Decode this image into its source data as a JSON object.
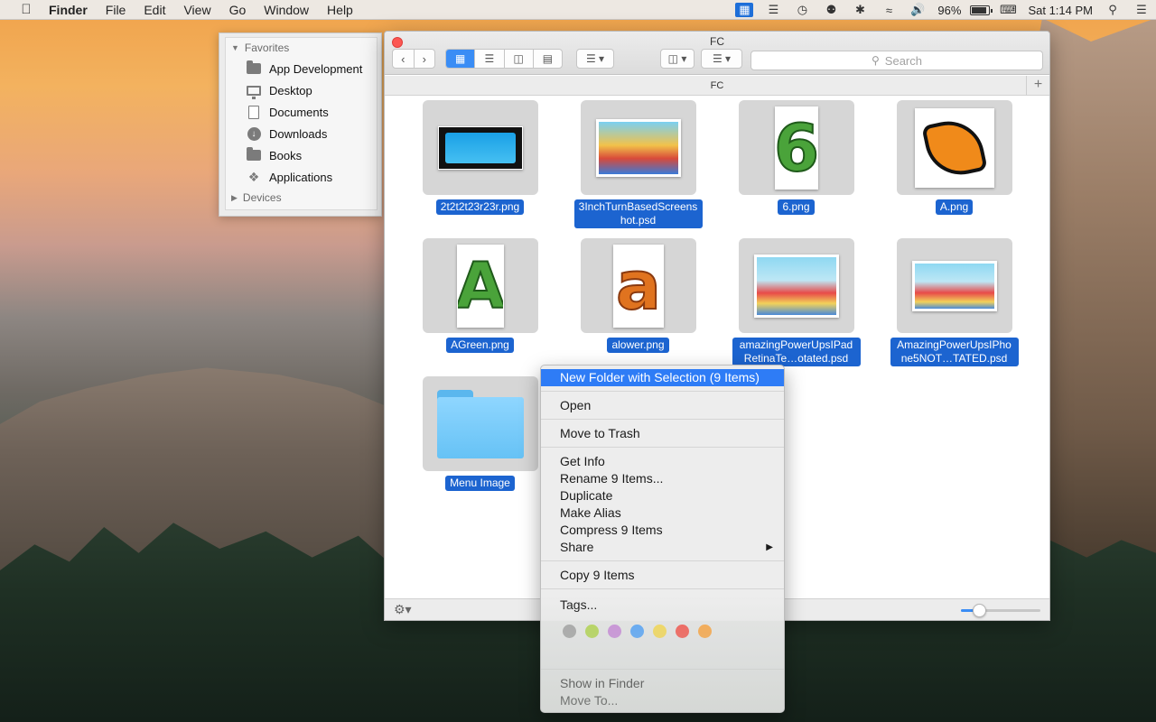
{
  "menubar": {
    "app_name": "Finder",
    "menus": [
      "File",
      "Edit",
      "View",
      "Go",
      "Window",
      "Help"
    ],
    "battery_percent": "96%",
    "clock": "Sat 1:14 PM"
  },
  "sidebar": {
    "favorites_header": "Favorites",
    "items": [
      {
        "label": "App Development",
        "icon": "folder-icon"
      },
      {
        "label": "Desktop",
        "icon": "desktop-icon"
      },
      {
        "label": "Documents",
        "icon": "documents-icon"
      },
      {
        "label": "Downloads",
        "icon": "downloads-icon"
      },
      {
        "label": "Books",
        "icon": "folder-icon"
      },
      {
        "label": "Applications",
        "icon": "applications-icon"
      }
    ],
    "devices_header": "Devices"
  },
  "window": {
    "title": "FC",
    "path_title": "FC",
    "search_placeholder": "Search"
  },
  "files": [
    {
      "name": "2t2t2t23r23r.png"
    },
    {
      "name": "3InchTurnBasedScreenshot.psd"
    },
    {
      "name": "6.png"
    },
    {
      "name": "A.png"
    },
    {
      "name": "AGreen.png"
    },
    {
      "name": "alower.png"
    },
    {
      "name": "amazingPowerUpsIPadRetinaTe…otated.psd"
    },
    {
      "name": "AmazingPowerUpsIPhone5NOT…TATED.psd"
    },
    {
      "name": "Menu Image"
    }
  ],
  "context_menu": {
    "new_folder": "New Folder with Selection (9 Items)",
    "open": "Open",
    "move_to_trash": "Move to Trash",
    "get_info": "Get Info",
    "rename": "Rename 9 Items...",
    "duplicate": "Duplicate",
    "make_alias": "Make Alias",
    "compress": "Compress 9 Items",
    "share": "Share",
    "copy": "Copy 9 Items",
    "tags": "Tags...",
    "tag_colors": [
      "#a6a6a6",
      "#b5d657",
      "#c98fd9",
      "#5aa6f7",
      "#f4d95a",
      "#f35d55",
      "#f9a84a"
    ],
    "show_in_finder": "Show in Finder",
    "move_to": "Move To..."
  },
  "icon_size_slider": {
    "value": 0.18
  }
}
